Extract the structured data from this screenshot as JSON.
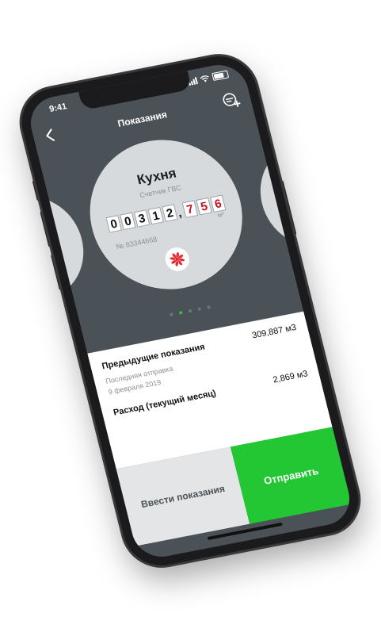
{
  "status_bar": {
    "time": "9:41"
  },
  "nav": {
    "title": "Показания"
  },
  "meter": {
    "name": "Кухня",
    "type": "Счетчик ГВС",
    "digits_integer": [
      "0",
      "0",
      "3",
      "1",
      "2"
    ],
    "digits_fraction": [
      "7",
      "5",
      "6"
    ],
    "unit": "м³",
    "serial": "№ 83344668"
  },
  "carousel": {
    "page_count": 5,
    "active_page": 2
  },
  "info": {
    "previous_label": "Предыдущие показания",
    "previous_value": "309,887 м3",
    "last_sent_label": "Последняя отправка",
    "last_sent_date": "9 февраля 2019",
    "consumption_label": "Расход (текущий месяц)",
    "consumption_value": "2,869 м3"
  },
  "actions": {
    "enter_label": "Ввести показания",
    "send_label": "Отправить"
  },
  "colors": {
    "accent": "#22c733",
    "screen_bg": "#4b5257",
    "fraction_digits": "#c4151c",
    "fan": "#e0282e"
  },
  "icons": {
    "back": "chevron-left-icon",
    "add": "add-meter-icon",
    "meter_kind": "fan-icon"
  }
}
